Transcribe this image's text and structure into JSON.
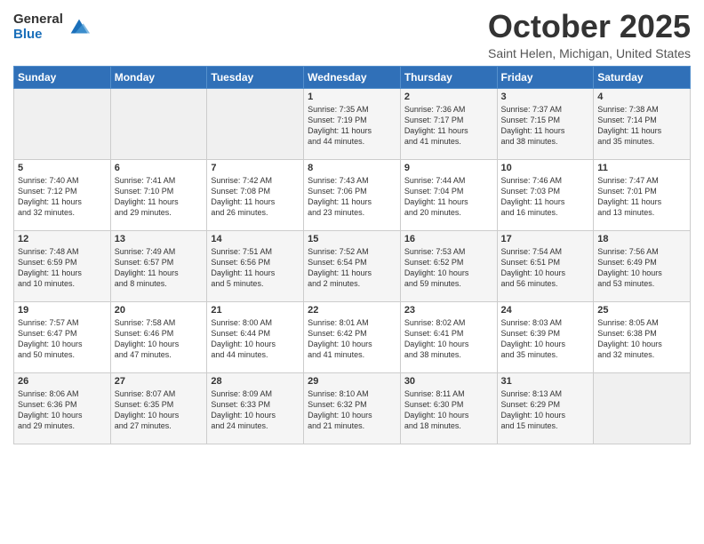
{
  "logo": {
    "general": "General",
    "blue": "Blue"
  },
  "header": {
    "month": "October 2025",
    "location": "Saint Helen, Michigan, United States"
  },
  "weekdays": [
    "Sunday",
    "Monday",
    "Tuesday",
    "Wednesday",
    "Thursday",
    "Friday",
    "Saturday"
  ],
  "weeks": [
    [
      {
        "day": "",
        "info": ""
      },
      {
        "day": "",
        "info": ""
      },
      {
        "day": "",
        "info": ""
      },
      {
        "day": "1",
        "info": "Sunrise: 7:35 AM\nSunset: 7:19 PM\nDaylight: 11 hours\nand 44 minutes."
      },
      {
        "day": "2",
        "info": "Sunrise: 7:36 AM\nSunset: 7:17 PM\nDaylight: 11 hours\nand 41 minutes."
      },
      {
        "day": "3",
        "info": "Sunrise: 7:37 AM\nSunset: 7:15 PM\nDaylight: 11 hours\nand 38 minutes."
      },
      {
        "day": "4",
        "info": "Sunrise: 7:38 AM\nSunset: 7:14 PM\nDaylight: 11 hours\nand 35 minutes."
      }
    ],
    [
      {
        "day": "5",
        "info": "Sunrise: 7:40 AM\nSunset: 7:12 PM\nDaylight: 11 hours\nand 32 minutes."
      },
      {
        "day": "6",
        "info": "Sunrise: 7:41 AM\nSunset: 7:10 PM\nDaylight: 11 hours\nand 29 minutes."
      },
      {
        "day": "7",
        "info": "Sunrise: 7:42 AM\nSunset: 7:08 PM\nDaylight: 11 hours\nand 26 minutes."
      },
      {
        "day": "8",
        "info": "Sunrise: 7:43 AM\nSunset: 7:06 PM\nDaylight: 11 hours\nand 23 minutes."
      },
      {
        "day": "9",
        "info": "Sunrise: 7:44 AM\nSunset: 7:04 PM\nDaylight: 11 hours\nand 20 minutes."
      },
      {
        "day": "10",
        "info": "Sunrise: 7:46 AM\nSunset: 7:03 PM\nDaylight: 11 hours\nand 16 minutes."
      },
      {
        "day": "11",
        "info": "Sunrise: 7:47 AM\nSunset: 7:01 PM\nDaylight: 11 hours\nand 13 minutes."
      }
    ],
    [
      {
        "day": "12",
        "info": "Sunrise: 7:48 AM\nSunset: 6:59 PM\nDaylight: 11 hours\nand 10 minutes."
      },
      {
        "day": "13",
        "info": "Sunrise: 7:49 AM\nSunset: 6:57 PM\nDaylight: 11 hours\nand 8 minutes."
      },
      {
        "day": "14",
        "info": "Sunrise: 7:51 AM\nSunset: 6:56 PM\nDaylight: 11 hours\nand 5 minutes."
      },
      {
        "day": "15",
        "info": "Sunrise: 7:52 AM\nSunset: 6:54 PM\nDaylight: 11 hours\nand 2 minutes."
      },
      {
        "day": "16",
        "info": "Sunrise: 7:53 AM\nSunset: 6:52 PM\nDaylight: 10 hours\nand 59 minutes."
      },
      {
        "day": "17",
        "info": "Sunrise: 7:54 AM\nSunset: 6:51 PM\nDaylight: 10 hours\nand 56 minutes."
      },
      {
        "day": "18",
        "info": "Sunrise: 7:56 AM\nSunset: 6:49 PM\nDaylight: 10 hours\nand 53 minutes."
      }
    ],
    [
      {
        "day": "19",
        "info": "Sunrise: 7:57 AM\nSunset: 6:47 PM\nDaylight: 10 hours\nand 50 minutes."
      },
      {
        "day": "20",
        "info": "Sunrise: 7:58 AM\nSunset: 6:46 PM\nDaylight: 10 hours\nand 47 minutes."
      },
      {
        "day": "21",
        "info": "Sunrise: 8:00 AM\nSunset: 6:44 PM\nDaylight: 10 hours\nand 44 minutes."
      },
      {
        "day": "22",
        "info": "Sunrise: 8:01 AM\nSunset: 6:42 PM\nDaylight: 10 hours\nand 41 minutes."
      },
      {
        "day": "23",
        "info": "Sunrise: 8:02 AM\nSunset: 6:41 PM\nDaylight: 10 hours\nand 38 minutes."
      },
      {
        "day": "24",
        "info": "Sunrise: 8:03 AM\nSunset: 6:39 PM\nDaylight: 10 hours\nand 35 minutes."
      },
      {
        "day": "25",
        "info": "Sunrise: 8:05 AM\nSunset: 6:38 PM\nDaylight: 10 hours\nand 32 minutes."
      }
    ],
    [
      {
        "day": "26",
        "info": "Sunrise: 8:06 AM\nSunset: 6:36 PM\nDaylight: 10 hours\nand 29 minutes."
      },
      {
        "day": "27",
        "info": "Sunrise: 8:07 AM\nSunset: 6:35 PM\nDaylight: 10 hours\nand 27 minutes."
      },
      {
        "day": "28",
        "info": "Sunrise: 8:09 AM\nSunset: 6:33 PM\nDaylight: 10 hours\nand 24 minutes."
      },
      {
        "day": "29",
        "info": "Sunrise: 8:10 AM\nSunset: 6:32 PM\nDaylight: 10 hours\nand 21 minutes."
      },
      {
        "day": "30",
        "info": "Sunrise: 8:11 AM\nSunset: 6:30 PM\nDaylight: 10 hours\nand 18 minutes."
      },
      {
        "day": "31",
        "info": "Sunrise: 8:13 AM\nSunset: 6:29 PM\nDaylight: 10 hours\nand 15 minutes."
      },
      {
        "day": "",
        "info": ""
      }
    ]
  ]
}
